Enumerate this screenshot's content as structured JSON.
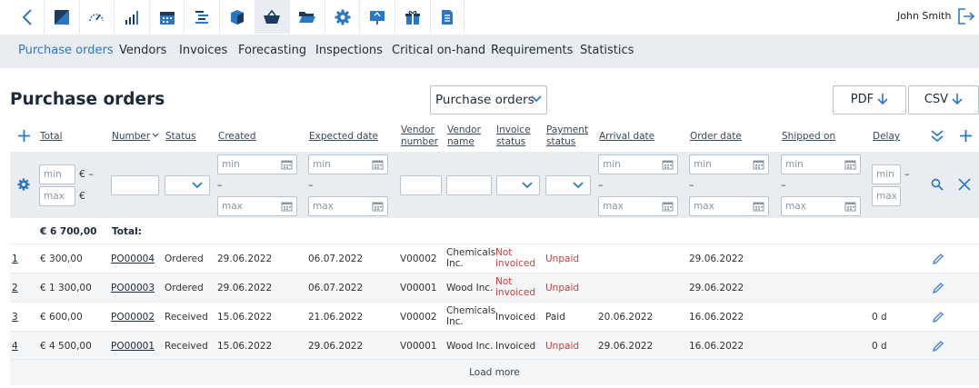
{
  "user": {
    "name": "John Smith"
  },
  "app_icons": [
    "dashboard-icon",
    "speed-gauge-icon",
    "signal-bars-icon",
    "calendar-icon",
    "list-tree-icon",
    "box-icon",
    "basket-icon",
    "folder-open-icon",
    "gear-icon",
    "presentation-icon",
    "gift-icon",
    "document-icon"
  ],
  "nav": [
    "Purchase orders",
    "Vendors",
    "Invoices",
    "Forecasting",
    "Inspections",
    "Critical on-hand",
    "Requirements",
    "Statistics"
  ],
  "page_title": "Purchase orders",
  "view_select": "Purchase orders",
  "export": {
    "pdf": "PDF",
    "csv": "CSV"
  },
  "columns": {
    "total": "Total",
    "number": "Number",
    "status": "Status",
    "created": "Created",
    "expected": "Expected date",
    "vendor_number_1": "Vendor",
    "vendor_number_2": "number",
    "vendor_name_1": "Vendor",
    "vendor_name_2": "name",
    "invoice_status_1": "Invoice",
    "invoice_status_2": "status",
    "payment_status_1": "Payment",
    "payment_status_2": "status",
    "arrival": "Arrival date",
    "order": "Order date",
    "shipped": "Shipped on",
    "delay": "Delay"
  },
  "filters": {
    "min": "min",
    "max": "max",
    "currency": "€",
    "dash": "–"
  },
  "totals": {
    "amount": "€ 6 700,00",
    "label": "Total:"
  },
  "rows": [
    {
      "idx": "1",
      "total": "€ 300,00",
      "number": "PO00004",
      "status": "Ordered",
      "created": "29.06.2022",
      "expected": "06.07.2022",
      "vendor_number": "V00002",
      "vendor_name_1": "Chemicals",
      "vendor_name_2": "Inc.",
      "invoice_1": "Not",
      "invoice_2": "invoiced",
      "payment": "Unpaid",
      "arrival": "",
      "order": "29.06.2022",
      "delay": ""
    },
    {
      "idx": "2",
      "total": "€ 1 300,00",
      "number": "PO00003",
      "status": "Ordered",
      "created": "29.06.2022",
      "expected": "06.07.2022",
      "vendor_number": "V00001",
      "vendor_name_1": "Wood Inc.",
      "vendor_name_2": "",
      "invoice_1": "Not",
      "invoice_2": "invoiced",
      "payment": "Unpaid",
      "arrival": "",
      "order": "29.06.2022",
      "delay": ""
    },
    {
      "idx": "3",
      "total": "€ 600,00",
      "number": "PO00002",
      "status": "Received",
      "created": "15.06.2022",
      "expected": "21.06.2022",
      "vendor_number": "V00002",
      "vendor_name_1": "Chemicals",
      "vendor_name_2": "Inc.",
      "invoice_1": "Invoiced",
      "invoice_2": "",
      "payment": "Paid",
      "arrival": "20.06.2022",
      "order": "16.06.2022",
      "delay": "0 d"
    },
    {
      "idx": "4",
      "total": "€ 4 500,00",
      "number": "PO00001",
      "status": "Received",
      "created": "15.06.2022",
      "expected": "29.06.2022",
      "vendor_number": "V00001",
      "vendor_name_1": "Wood Inc.",
      "vendor_name_2": "",
      "invoice_1": "Invoiced",
      "invoice_2": "",
      "payment": "Unpaid",
      "arrival": "29.06.2022",
      "order": "16.06.2022",
      "delay": "0 d"
    }
  ],
  "load_more": "Load more",
  "colors": {
    "accent": "#2a78c5",
    "nav_bg": "#e9edf1",
    "unpaid": "#d63a3a",
    "title": "#1c2a3c"
  }
}
